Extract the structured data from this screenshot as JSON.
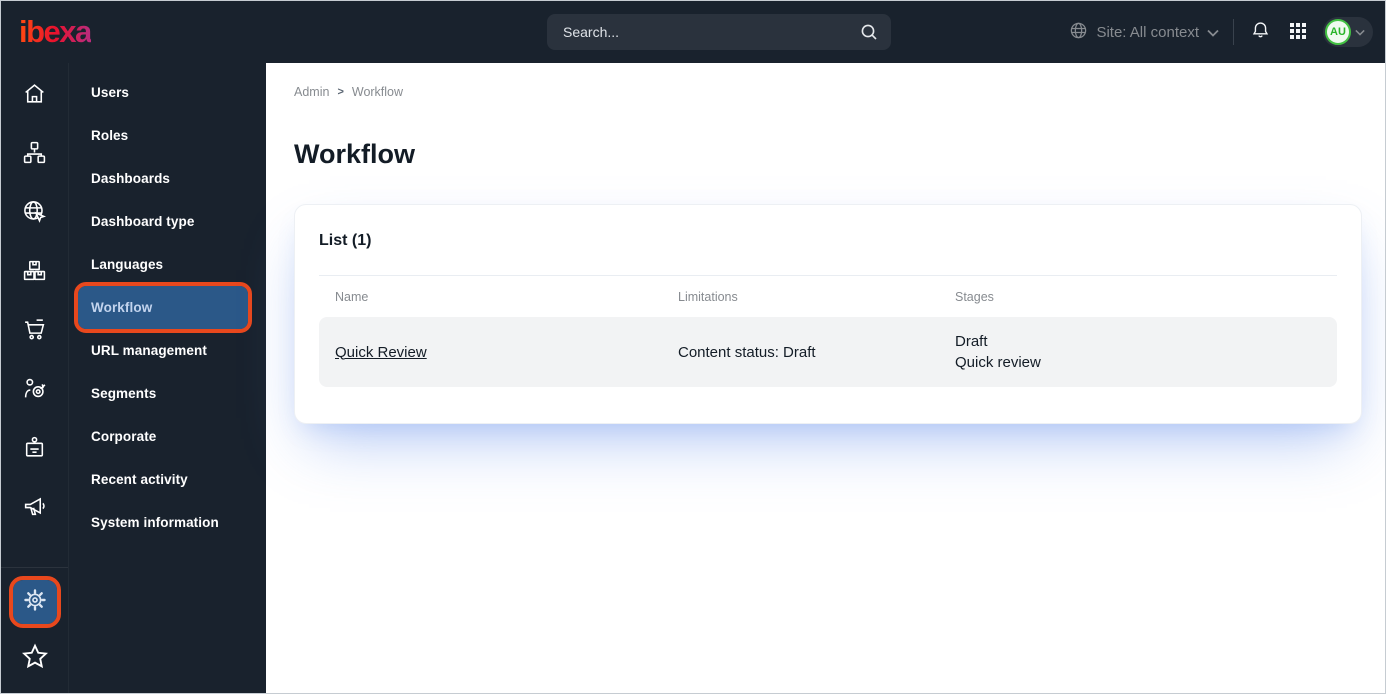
{
  "topbar": {
    "logo_text": "ibexa",
    "search_placeholder": "Search...",
    "site_context_label": "Site: All context",
    "avatar_initials": "AU",
    "icons": [
      "search-icon",
      "globe-icon",
      "chevron-down-icon",
      "bell-icon",
      "app-grid-icon"
    ]
  },
  "rail": {
    "icons": [
      "home-icon",
      "content-structure-icon",
      "site-globe-icon",
      "product-boxes-icon",
      "commerce-cart-icon",
      "personalization-target-icon",
      "customer-badge-icon",
      "marketing-megaphone-icon",
      "settings-gear-icon",
      "bookmarks-star-icon"
    ]
  },
  "sidebar": {
    "items": [
      {
        "label": "Users",
        "active": false
      },
      {
        "label": "Roles",
        "active": false
      },
      {
        "label": "Dashboards",
        "active": false
      },
      {
        "label": "Dashboard type",
        "active": false
      },
      {
        "label": "Languages",
        "active": false
      },
      {
        "label": "Workflow",
        "active": true
      },
      {
        "label": "URL management",
        "active": false
      },
      {
        "label": "Segments",
        "active": false
      },
      {
        "label": "Corporate",
        "active": false
      },
      {
        "label": "Recent activity",
        "active": false
      },
      {
        "label": "System information",
        "active": false
      }
    ]
  },
  "main": {
    "breadcrumb": {
      "0": "Admin",
      "separator": ">",
      "1": "Workflow"
    },
    "title": "Workflow",
    "card": {
      "heading": "List (1)",
      "columns": [
        "Name",
        "Limitations",
        "Stages"
      ],
      "rows": [
        {
          "name": "Quick Review",
          "limitations": "Content status: Draft",
          "stages": [
            "Draft",
            "Quick review"
          ]
        }
      ]
    }
  },
  "colors": {
    "topbar_bg": "#19222d",
    "accent_orange": "#e8481d",
    "active_blue": "#2b5888",
    "active_text": "#c3d4ee",
    "logo_gradient": [
      "#ff4713",
      "#e8112d",
      "#bb2b7a"
    ],
    "avatar_green": "#28b428",
    "row_bg": "#f2f3f4",
    "muted_text": "#878b90",
    "dark_text": "#131c26"
  }
}
